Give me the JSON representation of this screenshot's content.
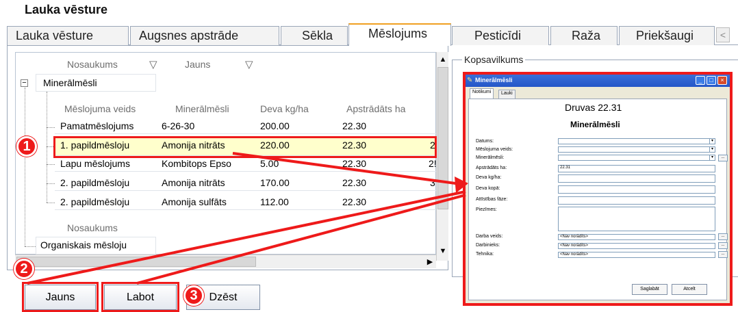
{
  "page": {
    "title": "Lauka vēsture"
  },
  "tabs": [
    {
      "label": "Lauka vēsture"
    },
    {
      "label": "Augsnes apstrāde"
    },
    {
      "label": "Sēkla"
    },
    {
      "label": "Mēslojums"
    },
    {
      "label": "Pesticīdi"
    },
    {
      "label": "Raža"
    },
    {
      "label": "Priekšaugi"
    }
  ],
  "tab_scroll_left": "<",
  "grid": {
    "top_headers": {
      "name": "Nosaukums",
      "new": "Jauns"
    },
    "group1": {
      "name": "Minerālmēsli",
      "expander": "−"
    },
    "sub_headers": [
      "Mēslojuma veids",
      "Minerālmēsli",
      "Deva kg/ha",
      "Apstrādāts ha"
    ],
    "rows": [
      {
        "type": "Pamatmēslojums",
        "fert": "6-26-30",
        "dose": "200.00",
        "ha": "22.30",
        "extra": ""
      },
      {
        "type": "1. papildmēsloju",
        "fert": "Amonija nitrāts",
        "dose": "220.00",
        "ha": "22.30",
        "extra": "2"
      },
      {
        "type": "Lapu mēslojums",
        "fert": "Kombitops Epso",
        "dose": "5.00",
        "ha": "22.30",
        "extra": "2!"
      },
      {
        "type": "2. papildmēsloju",
        "fert": "Amonija nitrāts",
        "dose": "170.00",
        "ha": "22.30",
        "extra": "3"
      },
      {
        "type": "2. papildmēsloju",
        "fert": "Amonija sulfāts",
        "dose": "112.00",
        "ha": "22.30",
        "extra": ""
      }
    ],
    "group2_header": "Nosaukums",
    "group2": {
      "name": "Organiskais mēsloju"
    }
  },
  "buttons": {
    "new": "Jauns",
    "edit": "Labot",
    "delete": "Dzēst"
  },
  "badges": [
    "1",
    "2",
    "3"
  ],
  "summary": {
    "label": "Kopsavilkums"
  },
  "dialog": {
    "title": "Minerālmēsli",
    "tabs": [
      "Notikumi",
      "Lauki"
    ],
    "field_name": "Druvas 22.31",
    "heading": "Minerālmēsli",
    "labels": [
      "Datums:",
      "Mēslojuma veids:",
      "Minerālmēsli:",
      "Apstrādāts ha:",
      "Deva kg/ha:",
      "Deva kopā:",
      "Attīstības fāze:",
      "Piezīmes:",
      "Darba veids:",
      "Darbinieks:",
      "Tehnika:"
    ],
    "values": {
      "area": "22.31",
      "not_set": "<Nav norādīts>"
    },
    "buttons": {
      "save": "Saglabāt",
      "cancel": "Atcelt"
    },
    "dropdown_glyph": "▾",
    "ellipsis": "..."
  },
  "colors": {
    "highlight": "#ee1a1a",
    "selected_row": "#ffffcc",
    "active_tab_accent": "#f0a020",
    "dialog_title": "#2456c8"
  }
}
